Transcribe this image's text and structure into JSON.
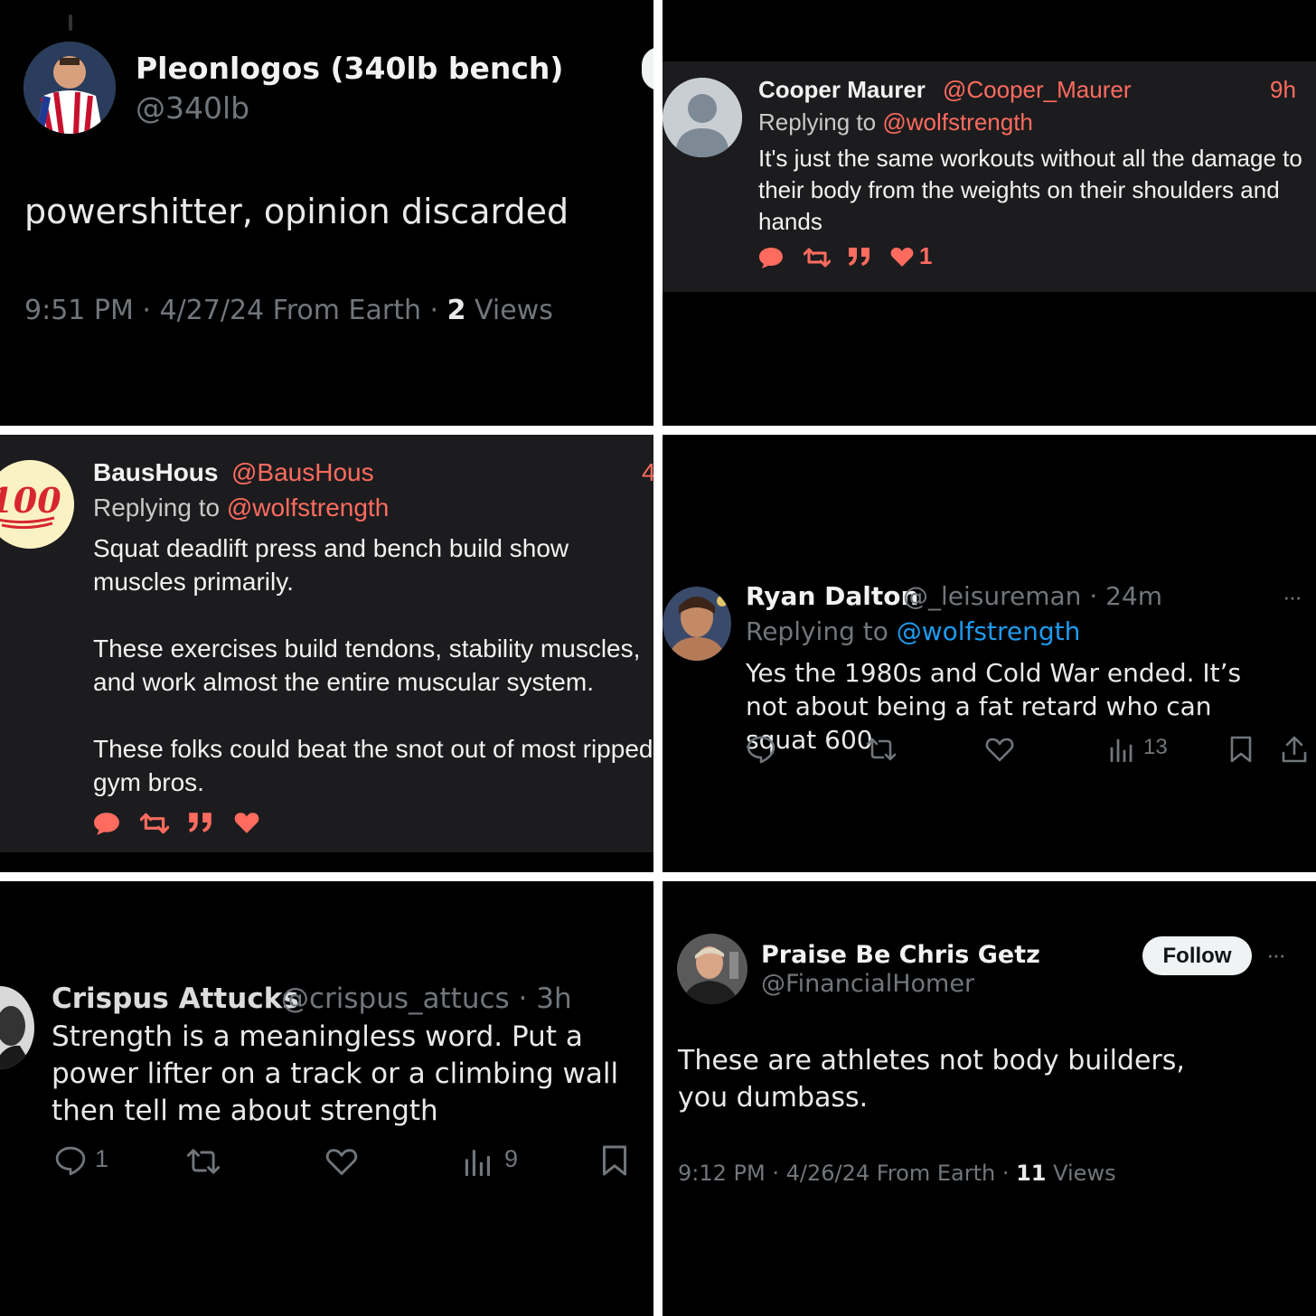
{
  "colors": {
    "background": "#000000",
    "card": "#1c1c1e",
    "text": "#e7e9ea",
    "muted": "#71767b",
    "link_blue": "#1d9bf0",
    "accent_coral": "#ff6b5f",
    "divider": "#ffffff"
  },
  "post1": {
    "display_name": "Pleonlogos (340lb bench)",
    "handle": "@340lb",
    "text": "powershitter, opinion discarded",
    "time": "9:51 PM · 4/27/24 From Earth · ",
    "views_count": "2",
    "views_label": " Views"
  },
  "post2": {
    "display_name": "Cooper Maurer",
    "handle": "@Cooper_Maurer",
    "age": "9h",
    "replying_prefix": "Replying to ",
    "replying_handle": "@wolfstrength",
    "text": "It's just the same workouts without all the damage to their body from the weights on their shoulders and hands",
    "like_count": "1",
    "icons": [
      "reply-icon",
      "retweet-icon",
      "quote-icon",
      "heart-icon"
    ]
  },
  "post3": {
    "display_name": "BausHous",
    "handle": "@BausHous",
    "age": "4",
    "avatar_text": "100",
    "replying_prefix": "Replying to ",
    "replying_handle": "@wolfstrength",
    "para1": "Squat deadlift press and bench build show muscles primarily.",
    "para2": "These exercises build tendons, stability muscles, and work almost the entire muscular system.",
    "para3": "These folks could beat the snot out of most ripped gym bros.",
    "icons": [
      "reply-icon",
      "retweet-icon",
      "quote-icon",
      "heart-icon"
    ]
  },
  "post4": {
    "display_name": "Ryan Dalton",
    "handle": "@_leisureman",
    "age": " · 24m",
    "more": "···",
    "replying_prefix": "Replying to ",
    "replying_handle": "@wolfstrength",
    "text": "Yes the 1980s and Cold War ended. It’s not about being a fat retard who can squat 600",
    "views": "13",
    "icons": [
      "reply-icon",
      "retweet-icon",
      "heart-icon",
      "views-icon",
      "bookmark-icon",
      "share-icon"
    ]
  },
  "post5": {
    "display_name": "Crispus Attucks",
    "handle": "@crispus_attucs",
    "age": " · 3h",
    "text": "Strength is a meaningless word. Put a power lifter on a track or a climbing wall then tell me about strength",
    "reply_count": "1",
    "views": "9",
    "icons": [
      "reply-icon",
      "retweet-icon",
      "heart-icon",
      "views-icon",
      "bookmark-icon"
    ]
  },
  "post6": {
    "display_name": "Praise Be Chris Getz",
    "handle": "@FinancialHomer",
    "follow_label": "Follow",
    "more": "···",
    "text": "These are athletes not body builders, you dumbass.",
    "time": "9:12 PM · 4/26/24 From Earth · ",
    "views_count": "11",
    "views_label": " Views"
  }
}
